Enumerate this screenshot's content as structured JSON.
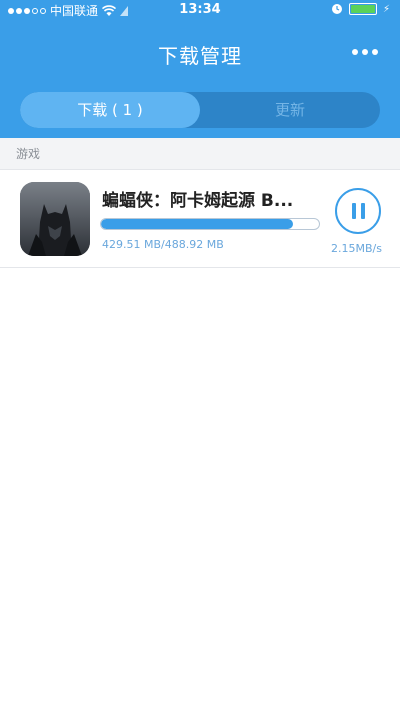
{
  "status_bar": {
    "carrier": "中国联通",
    "time": "13:34",
    "wifi_icon": "wifi-icon",
    "alarm_icon": "alarm-icon",
    "charging_icon": "charging-icon"
  },
  "header": {
    "title": "下载管理",
    "more_icon": "more-icon",
    "background_color": "#3a9ee8"
  },
  "tabs": [
    {
      "label": "下载 ( 1 )",
      "active": true
    },
    {
      "label": "更新",
      "active": false
    }
  ],
  "section": {
    "label": "游戏"
  },
  "download_item": {
    "name": "蝙蝠侠：阿卡姆起源 B...",
    "progress_fraction": 0.8798,
    "size_text": "429.51 MB/488.92 MB",
    "speed_text": "2.15MB/s",
    "action_icon": "pause-icon"
  }
}
